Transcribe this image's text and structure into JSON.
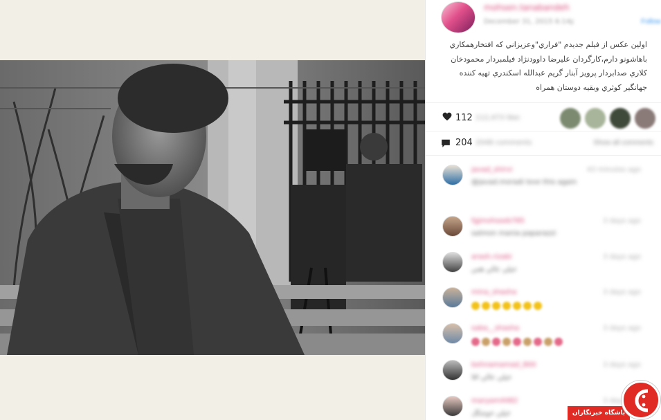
{
  "post": {
    "owner_name": "mohsen.tanabandeh",
    "date": "December 31, 2015 6:14pm",
    "follow_label": "Follow",
    "caption_lines": [
      "اولين عكس از فيلم جديدم \"فراري\"وعزيزاني كه افتخارهمكاري",
      "باهاشونو دارم،كارگردان عليرضا داوودنژاد فيلمبردار محمودخان",
      "كلاري صدابردار پرويز آبنار گريم عبدالله اسكندري تهيه كننده",
      "جهانگير كوثري وبقيه دوستان همراه"
    ],
    "likes_count": "112",
    "likes_suffix": "112,473 likes",
    "comments_count": "204",
    "comments_suffix": "2048 comments",
    "show_all_label": "Show all comments"
  },
  "colors": {
    "background": "#f2f0e6",
    "accent": "#d94b7a",
    "logo": "#e02b24"
  },
  "icons": {
    "like": "heart-icon",
    "comment": "speech-bubble-icon",
    "logo": "site-logo-icon"
  },
  "comments": [
    {
      "user": "javad_shirvi",
      "time": "43 minutes ago",
      "text": "@javad.moradi love this again"
    },
    {
      "user": "fgjmohsseb785",
      "time": "3 days ago",
      "text": "salmon mania paparazzi"
    },
    {
      "user": "arash.rizabi",
      "time": "3 days ago",
      "text": "خيلي عالي هس"
    },
    {
      "user": "mina_shasha",
      "time": "3 days ago",
      "text": ""
    },
    {
      "user": "saba__shasha",
      "time": "3 days ago",
      "text": ""
    },
    {
      "user": "behnamamad_800",
      "time": "3 days ago",
      "text": "خيلي عالي آقا"
    },
    {
      "user": "maryam4482",
      "time": "3 days ago",
      "text": "خيلي خوشگل"
    }
  ],
  "watermark": {
    "banner_text": "باشگاه خبرنگاران"
  }
}
